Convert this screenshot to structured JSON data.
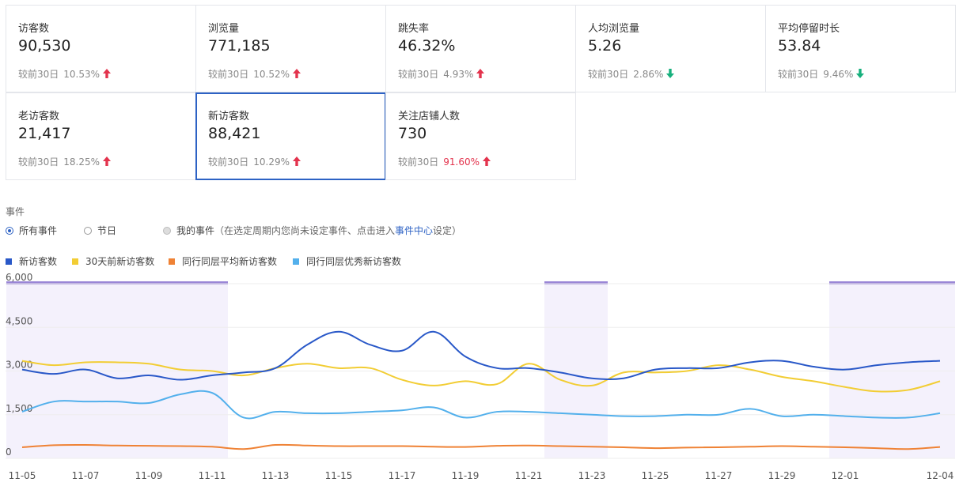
{
  "metrics": [
    {
      "title": "访客数",
      "value": "90,530",
      "compare_label": "较前30日",
      "change": "10.53%",
      "direction": "up",
      "highlight": false,
      "selected": false
    },
    {
      "title": "浏览量",
      "value": "771,185",
      "compare_label": "较前30日",
      "change": "10.52%",
      "direction": "up",
      "highlight": false,
      "selected": false
    },
    {
      "title": "跳失率",
      "value": "46.32%",
      "compare_label": "较前30日",
      "change": "4.93%",
      "direction": "up",
      "highlight": false,
      "selected": false
    },
    {
      "title": "人均浏览量",
      "value": "5.26",
      "compare_label": "较前30日",
      "change": "2.86%",
      "direction": "down",
      "highlight": false,
      "selected": false
    },
    {
      "title": "平均停留时长",
      "value": "53.84",
      "compare_label": "较前30日",
      "change": "9.46%",
      "direction": "down",
      "highlight": false,
      "selected": false
    },
    {
      "title": "老访客数",
      "value": "21,417",
      "compare_label": "较前30日",
      "change": "18.25%",
      "direction": "up",
      "highlight": false,
      "selected": false
    },
    {
      "title": "新访客数",
      "value": "88,421",
      "compare_label": "较前30日",
      "change": "10.29%",
      "direction": "up",
      "highlight": false,
      "selected": true
    },
    {
      "title": "关注店铺人数",
      "value": "730",
      "compare_label": "较前30日",
      "change": "91.60%",
      "direction": "up",
      "highlight": true,
      "selected": false
    }
  ],
  "events": {
    "title": "事件",
    "options": [
      {
        "label": "所有事件",
        "checked": true,
        "disabled": false
      },
      {
        "label": "节日",
        "checked": false,
        "disabled": false
      },
      {
        "label": "我的事件",
        "checked": false,
        "disabled": true
      }
    ],
    "note_prefix": "（在选定周期内您尚未设定事件、点击进入",
    "note_link": "事件中心",
    "note_suffix": "设定）"
  },
  "colors": {
    "up_arrow": "#e3334d",
    "down_arrow": "#17b07d",
    "selected_border": "#2d62c4",
    "event_band": "#9a86d6"
  },
  "chart_data": {
    "type": "line",
    "x": [
      "11-05",
      "11-06",
      "11-07",
      "11-08",
      "11-09",
      "11-10",
      "11-11",
      "11-12",
      "11-13",
      "11-14",
      "11-15",
      "11-16",
      "11-17",
      "11-18",
      "11-19",
      "11-20",
      "11-21",
      "11-22",
      "11-23",
      "11-24",
      "11-25",
      "11-26",
      "11-27",
      "11-28",
      "11-29",
      "11-30",
      "12-01",
      "12-02",
      "12-03",
      "12-04"
    ],
    "x_tick_labels": [
      "11-05",
      "11-07",
      "11-09",
      "11-11",
      "11-13",
      "11-15",
      "11-17",
      "11-19",
      "11-21",
      "11-23",
      "11-25",
      "11-27",
      "11-29",
      "12-01",
      "12-04"
    ],
    "y_ticks": [
      {
        "value": 0,
        "label": "0"
      },
      {
        "value": 1500,
        "label": "1,500"
      },
      {
        "value": 3000,
        "label": "3,000"
      },
      {
        "value": 4500,
        "label": "4,500"
      },
      {
        "value": 6000,
        "label": "6,000"
      }
    ],
    "ylim": [
      0,
      6000
    ],
    "grid": true,
    "event_periods": [
      {
        "start": "11-05",
        "end": "11-11"
      },
      {
        "start": "11-22",
        "end": "11-23"
      },
      {
        "start": "12-01",
        "end": "12-04"
      }
    ],
    "series": [
      {
        "name": "新访客数",
        "color": "#2958c8",
        "values": [
          3050,
          2900,
          3050,
          2750,
          2850,
          2700,
          2850,
          2950,
          3100,
          3900,
          4350,
          3900,
          3700,
          4350,
          3500,
          3100,
          3100,
          2950,
          2750,
          2750,
          3050,
          3100,
          3100,
          3300,
          3350,
          3150,
          3050,
          3200,
          3300,
          3350
        ]
      },
      {
        "name": "30天前新访客数",
        "color": "#f2cd34",
        "values": [
          3350,
          3200,
          3300,
          3300,
          3250,
          3050,
          3000,
          2850,
          3100,
          3250,
          3100,
          3100,
          2700,
          2500,
          2650,
          2550,
          3250,
          2700,
          2500,
          2950,
          2950,
          3000,
          3200,
          3050,
          2800,
          2650,
          2450,
          2300,
          2350,
          2650
        ]
      },
      {
        "name": "同行同层平均新访客数",
        "color": "#ef8235",
        "values": [
          380,
          450,
          460,
          440,
          430,
          420,
          400,
          320,
          460,
          440,
          420,
          420,
          420,
          400,
          390,
          430,
          440,
          420,
          400,
          380,
          350,
          370,
          380,
          400,
          420,
          400,
          380,
          350,
          320,
          390
        ]
      },
      {
        "name": "同行同层优秀新访客数",
        "color": "#53b0ec",
        "values": [
          1600,
          1950,
          1950,
          1950,
          1900,
          2200,
          2250,
          1400,
          1600,
          1550,
          1550,
          1600,
          1650,
          1750,
          1400,
          1600,
          1600,
          1550,
          1500,
          1450,
          1450,
          1500,
          1500,
          1700,
          1450,
          1500,
          1450,
          1400,
          1400,
          1550
        ]
      }
    ]
  }
}
